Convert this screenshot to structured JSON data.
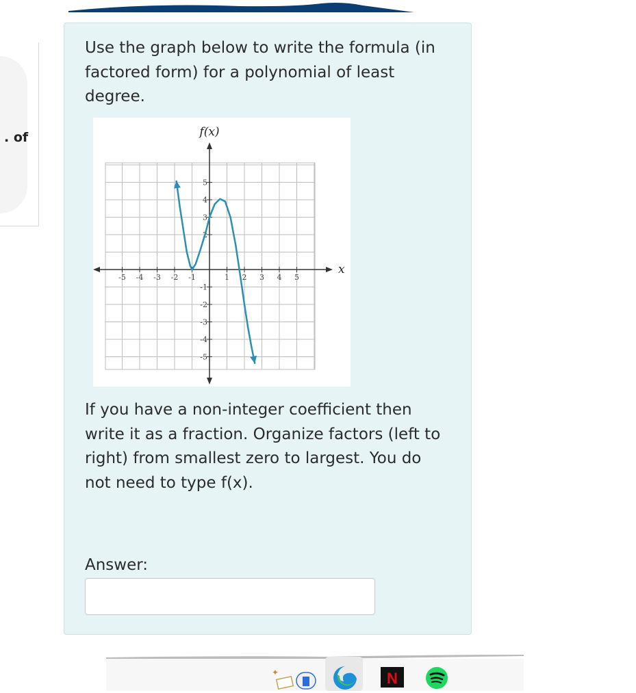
{
  "side": {
    "label": ". of"
  },
  "question": {
    "prompt": "Use the graph below to write the formula (in factored form) for a polynomial of least degree.",
    "instructions": "If you have a non-integer coefficient then write it as a fraction. Organize factors (left to right) from smallest zero to largest. You do not need to type f(x).",
    "answer_label": "Answer:",
    "answer_value": ""
  },
  "graph": {
    "y_axis_label": "f(x)",
    "x_axis_label": "x",
    "x_ticks": [
      "-5",
      "-4",
      "-3",
      "-2",
      "-1",
      "1",
      "2",
      "3",
      "4",
      "5"
    ],
    "y_ticks": [
      "5",
      "4",
      "3",
      "2",
      "-1",
      "-2",
      "-3",
      "-4",
      "-5"
    ],
    "curve_color": "#2b8fb5"
  },
  "chart_data": {
    "type": "line",
    "title": "",
    "xlabel": "x",
    "ylabel": "f(x)",
    "xlim": [
      -6,
      6
    ],
    "ylim": [
      -6,
      6
    ],
    "grid": true,
    "series": [
      {
        "x": [
          -1.9,
          -1.7,
          -1.5,
          -1.3,
          -1.1,
          -1.0,
          -0.8,
          -0.5,
          -0.2,
          0.0,
          0.3,
          0.6,
          0.9,
          1.2,
          1.5,
          1.8,
          2.0,
          2.2,
          2.4,
          2.6
        ],
        "y": [
          5.1,
          3.6,
          2.3,
          1.0,
          0.2,
          0.0,
          0.3,
          1.2,
          2.2,
          3.0,
          3.75,
          4.05,
          3.9,
          3.0,
          1.4,
          -0.6,
          -2.0,
          -3.3,
          -4.4,
          -5.4
        ]
      }
    ]
  },
  "taskbar": {
    "icons": [
      "notes-app-icon",
      "edge-browser-icon",
      "netflix-icon",
      "spotify-icon"
    ],
    "netflix_letter": "N"
  }
}
